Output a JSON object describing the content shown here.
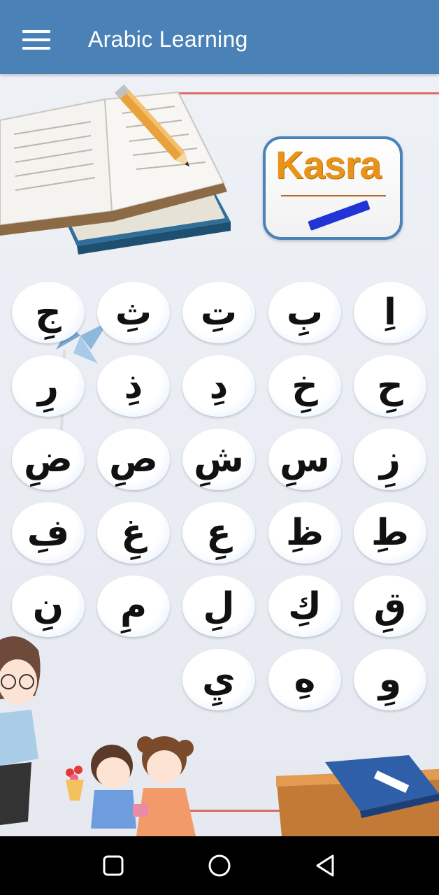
{
  "appbar": {
    "title": "Arabic Learning",
    "menu_icon": "menu-icon"
  },
  "badge": {
    "label": "Kasra"
  },
  "letters": [
    "ج",
    "ث",
    "ت",
    "ب",
    "ا",
    "ر",
    "ذ",
    "د",
    "خ",
    "ح",
    "ض",
    "ص",
    "ش",
    "س",
    "ز",
    "ف",
    "غ",
    "ع",
    "ظ",
    "ط",
    "ن",
    "م",
    "ل",
    "ك",
    "ق",
    "ي",
    "ه",
    "و"
  ],
  "letters_kasra": [
    "جِ",
    "ثِ",
    "تِ",
    "بِ",
    "اِ",
    "رِ",
    "ذِ",
    "دِ",
    "خِ",
    "حِ",
    "ضِ",
    "صِ",
    "شِ",
    "سِ",
    "زِ",
    "فِ",
    "غِ",
    "عِ",
    "ظِ",
    "طِ",
    "نِ",
    "مِ",
    "لِ",
    "كِ",
    "قِ",
    "يِ",
    "هِ",
    "وِ"
  ],
  "navbar": {
    "recents_icon": "square-icon",
    "home_icon": "circle-icon",
    "back_icon": "triangle-back-icon"
  },
  "colors": {
    "appbar": "#4a82b8",
    "badge_text": "#e8931a",
    "kasra_mark": "#2134d6"
  }
}
